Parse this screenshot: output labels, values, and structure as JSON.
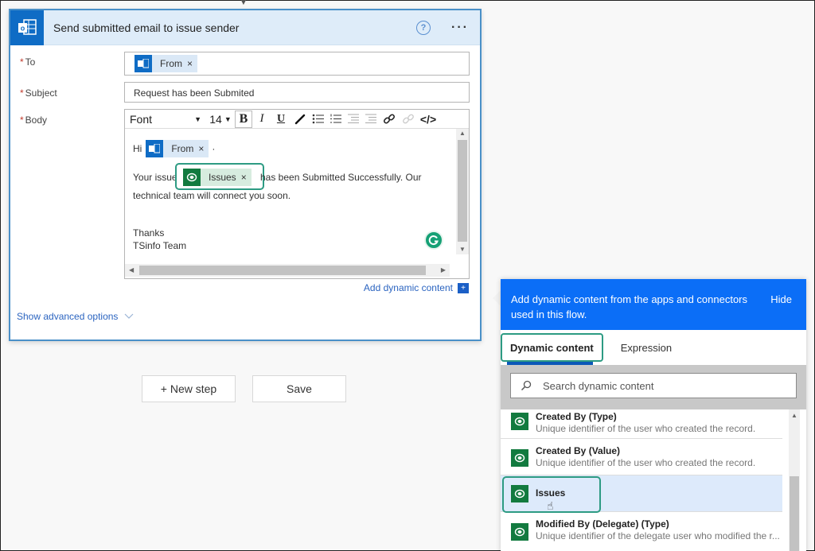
{
  "card": {
    "title": "Send submitted email to issue sender",
    "help_icon": "?",
    "more_icon": "···",
    "fields": {
      "to": {
        "label": "To",
        "required_mark": "*",
        "token": {
          "label": "From",
          "remove": "×",
          "icon": "outlook-icon"
        }
      },
      "subject": {
        "label": "Subject",
        "required_mark": "*",
        "value": "Request has been Submited"
      },
      "body": {
        "label": "Body",
        "required_mark": "*",
        "toolbar": {
          "font": "Font",
          "font_caret": "▼",
          "size": "14",
          "size_caret": "▼",
          "bold": "B",
          "italic": "I",
          "underline": "U",
          "code": "</>"
        },
        "content": {
          "greeting": "Hi",
          "greeting_token": {
            "label": "From",
            "remove": "×"
          },
          "greeting_suffix": "·",
          "line1_prefix": "Your issue",
          "line1_token": {
            "label": "Issues",
            "remove": "×"
          },
          "line1_suffix": "has been Submitted Successfully. Our",
          "line2": "technical team will connect you soon.",
          "sign1": "Thanks",
          "sign2": "TSinfo Team"
        }
      }
    },
    "add_dynamic_content": "Add dynamic content",
    "show_advanced": "Show advanced options"
  },
  "buttons": {
    "new_step": "+ New step",
    "save": "Save"
  },
  "panel": {
    "header_text": "Add dynamic content from the apps and connectors used in this flow.",
    "hide": "Hide",
    "tabs": [
      {
        "label": "Dynamic content",
        "active": true
      },
      {
        "label": "Expression",
        "active": false
      }
    ],
    "search_placeholder": "Search dynamic content",
    "items": [
      {
        "title": "Created By (Type)",
        "desc": "Unique identifier of the user who created the record."
      },
      {
        "title": "Created By (Value)",
        "desc": "Unique identifier of the user who created the record."
      },
      {
        "title": "Issues",
        "desc": "",
        "selected": true
      },
      {
        "title": "Modified By (Delegate) (Type)",
        "desc": "Unique identifier of the delegate user who modified the r..."
      }
    ]
  },
  "colors": {
    "accent_blue": "#0b6ef7",
    "outlook_blue": "#0f6cc5",
    "dataverse_green": "#127a3f",
    "highlight_teal": "#2d9b83",
    "header_bg": "#deecf9"
  }
}
